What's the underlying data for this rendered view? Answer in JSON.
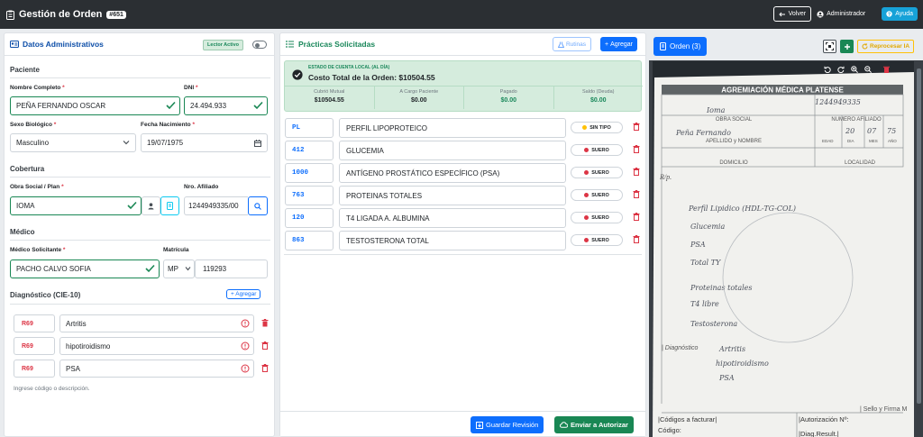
{
  "header": {
    "title": "Gestión de Orden",
    "order_badge": "#651",
    "back_label": "Volver",
    "user_label": "Administrador",
    "help_label": "Ayuda"
  },
  "admin": {
    "title": "Datos Administrativos",
    "reader_label": "Lector Activo",
    "patient_section": "Paciente",
    "full_name_label": "Nombre Completo",
    "full_name": "PEÑA FERNANDO OSCAR",
    "dni_label": "DNI",
    "dni": "24.494.933",
    "sex_label": "Sexo Biológico",
    "sex": "Masculino",
    "birth_label": "Fecha Nacimiento",
    "birth": "19/07/1975",
    "coverage_section": "Cobertura",
    "plan_label": "Obra Social / Plan",
    "plan": "IOMA",
    "affiliate_label": "Nro. Afiliado",
    "affiliate": "1244949335/00",
    "doctor_section": "Médico",
    "doctor_label": "Médico Solicitante",
    "doctor": "PACHO CALVO SOFIA",
    "license_label": "Matrícula",
    "license_type": "MP",
    "license": "119293",
    "diagnosis_section": "Diagnóstico (CIE-10)",
    "add_label": "Agregar",
    "diagnoses": [
      {
        "code": "R69",
        "desc": "Artritis"
      },
      {
        "code": "R69",
        "desc": "hipotiroidismo"
      },
      {
        "code": "R69",
        "desc": "PSA"
      }
    ],
    "hint": "Ingrese código o descripción."
  },
  "practices": {
    "title": "Prácticas Solicitadas",
    "routines_label": "Rutinas",
    "add_label": "Agregar",
    "account_state": "ESTADO DE CUENTA LOCAL (AL DÍA)",
    "total": "Costo Total de la Orden: $10504.55",
    "summary": [
      {
        "k": "Cubrió Mutual",
        "v": "$10504.55",
        "color": "#212529"
      },
      {
        "k": "A Cargo Paciente",
        "v": "$0.00",
        "color": "#212529"
      },
      {
        "k": "Pagado",
        "v": "$0.00",
        "color": "#19875a"
      },
      {
        "k": "Saldo (Deuda)",
        "v": "$0.00",
        "color": "#19875a"
      }
    ],
    "rows": [
      {
        "code": "PL",
        "name": "PERFIL LIPOPROTEICO",
        "tube": "SIN TIPO",
        "tube_color": "#ffc107"
      },
      {
        "code": "412",
        "name": "GLUCEMIA",
        "tube": "SUERO",
        "tube_color": "#dc3545"
      },
      {
        "code": "1000",
        "name": "ANTÍGENO PROSTÁTICO ESPECÍFICO (PSA)",
        "tube": "SUERO",
        "tube_color": "#dc3545"
      },
      {
        "code": "763",
        "name": "PROTEINAS TOTALES",
        "tube": "SUERO",
        "tube_color": "#dc3545"
      },
      {
        "code": "120",
        "name": "T4 LIGADA A. ALBUMINA",
        "tube": "SUERO",
        "tube_color": "#dc3545"
      },
      {
        "code": "863",
        "name": "TESTOSTERONA TOTAL",
        "tube": "SUERO",
        "tube_color": "#dc3545"
      }
    ],
    "save_label": "Guardar Revisión",
    "send_label": "Enviar a Autorizar"
  },
  "viewer": {
    "order_label": "Orden (3)",
    "reprocess_label": "Reprocesar IA",
    "doc_header": "AGREMIACIÓN MÉDICA PLATENSE",
    "doc_obra_social": "OBRA SOCIAL",
    "doc_numero": "NUMERO AFILIADO",
    "doc_apellido": "APELLIDO y NOMBRE",
    "doc_edad": "EDAD",
    "doc_dia": "DIA",
    "doc_mes": "MES",
    "doc_ano": "AÑO",
    "doc_domicilio": "DOMICILIO",
    "doc_localidad": "LOCALIDAD",
    "doc_rp": "R/p.",
    "doc_diag": "| Diagnóstico",
    "doc_sello": "| Sello y Firma M",
    "doc_codigos": "|Códigos a facturar|",
    "doc_autorizacion": "|Autorización Nº:",
    "doc_codigo": "Código:",
    "doc_diagres": "|Diag.Result.|",
    "hw_name": "Peña Fernando",
    "hw_aff": "1244949335",
    "hw_obra": "Ioma",
    "hw_dia": "20",
    "hw_mes": "07",
    "hw_ano": "75",
    "hw_lines": [
      "Perfil Lipidico (HDL-TG-COL)",
      "Glucemia",
      "PSA",
      "Total TY",
      "Proteinas totales",
      "T4 libre",
      "Testosterona"
    ],
    "hw_diag": "Artritis",
    "hw_diag2": "hipotiroidismo",
    "hw_diag3": "PSA"
  }
}
